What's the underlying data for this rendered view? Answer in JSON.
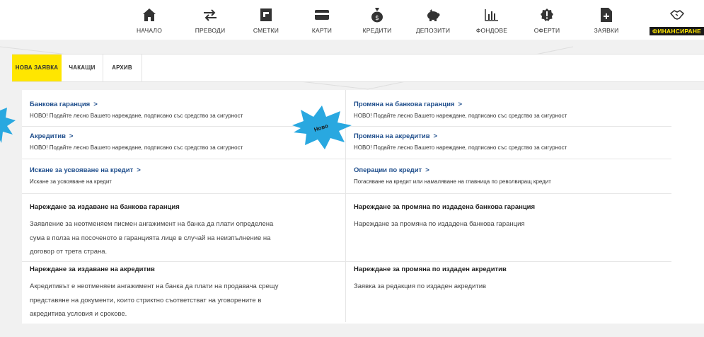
{
  "nav": [
    {
      "label": "НАЧАЛО",
      "icon": "home-icon"
    },
    {
      "label": "ПРЕВОДИ",
      "icon": "transfer-arrows-icon"
    },
    {
      "label": "СМЕТКИ",
      "icon": "account-card-icon"
    },
    {
      "label": "КАРТИ",
      "icon": "credit-card-icon"
    },
    {
      "label": "КРЕДИТИ",
      "icon": "money-bag-icon"
    },
    {
      "label": "ДЕПОЗИТИ",
      "icon": "piggy-bank-icon"
    },
    {
      "label": "ФОНДОВЕ",
      "icon": "bar-chart-icon"
    },
    {
      "label": "ОФЕРТИ",
      "icon": "offer-badge-icon"
    },
    {
      "label": "ЗАЯВКИ",
      "icon": "request-document-icon"
    },
    {
      "label": "ФИНАНСИРАНЕ",
      "icon": "handshake-icon",
      "active": true
    }
  ],
  "tabs": [
    {
      "label": "НОВА ЗАЯВКА",
      "active": true
    },
    {
      "label": "ЧАКАЩИ"
    },
    {
      "label": "АРХИВ"
    }
  ],
  "links": [
    {
      "title": "Банкова гаранция",
      "desc": "НОВО! Подайте лесно Вашето нареждане, подписано със средство за сигурност"
    },
    {
      "title": "Промяна на банкова гаранция",
      "desc": "НОВО! Подайте лесно Вашето нареждане, подписано със средство за сигурност"
    },
    {
      "title": "Акредитив",
      "desc": "НОВО! Подайте лесно Вашето нареждане, подписано със средство за сигурност"
    },
    {
      "title": "Промяна на акредитив",
      "desc": "НОВО! Подайте лесно Вашето нареждане, подписано със средство за сигурност"
    },
    {
      "title": "Искане за усвояване на кредит",
      "desc": "Искане за усвояване на кредит"
    },
    {
      "title": "Операции по кредит",
      "desc": "Погасяване на кредит или намаляване на главница по револвиращ кредит"
    }
  ],
  "blocks": [
    {
      "title": "Нареждане за издаване на банкова гаранция",
      "lines": [
        "Заявление за неотменяем писмен ангажимент на банка да плати определена",
        "сума в полза на посоченото в гаранцията лице в случай на неизпълнение на",
        "договор от трета страна."
      ]
    },
    {
      "title": "Нареждане за промяна по издадена банкова гаранция",
      "lines": [
        "Нареждане за промяна по издадена банкова гаранция"
      ]
    },
    {
      "title": "Нареждане за издаване на акредитив",
      "lines": [
        "Акредитивът е неотменяем ангажимент на банка да плати на продавача срещу",
        "представяне на документи, които стриктно съответстват на уговорените в",
        "акредитива условия и срокове."
      ]
    },
    {
      "title": "Нареждане за промяна по издаден акредитив",
      "lines": [
        "Заявка за редакция по издаден акредитив"
      ]
    }
  ],
  "badge": {
    "label": "Ново",
    "color": "#29a8e0"
  },
  "colors": {
    "accent": "#ffe600",
    "link": "#1f4e8c",
    "nav_active_bg": "#1a1a1a"
  }
}
